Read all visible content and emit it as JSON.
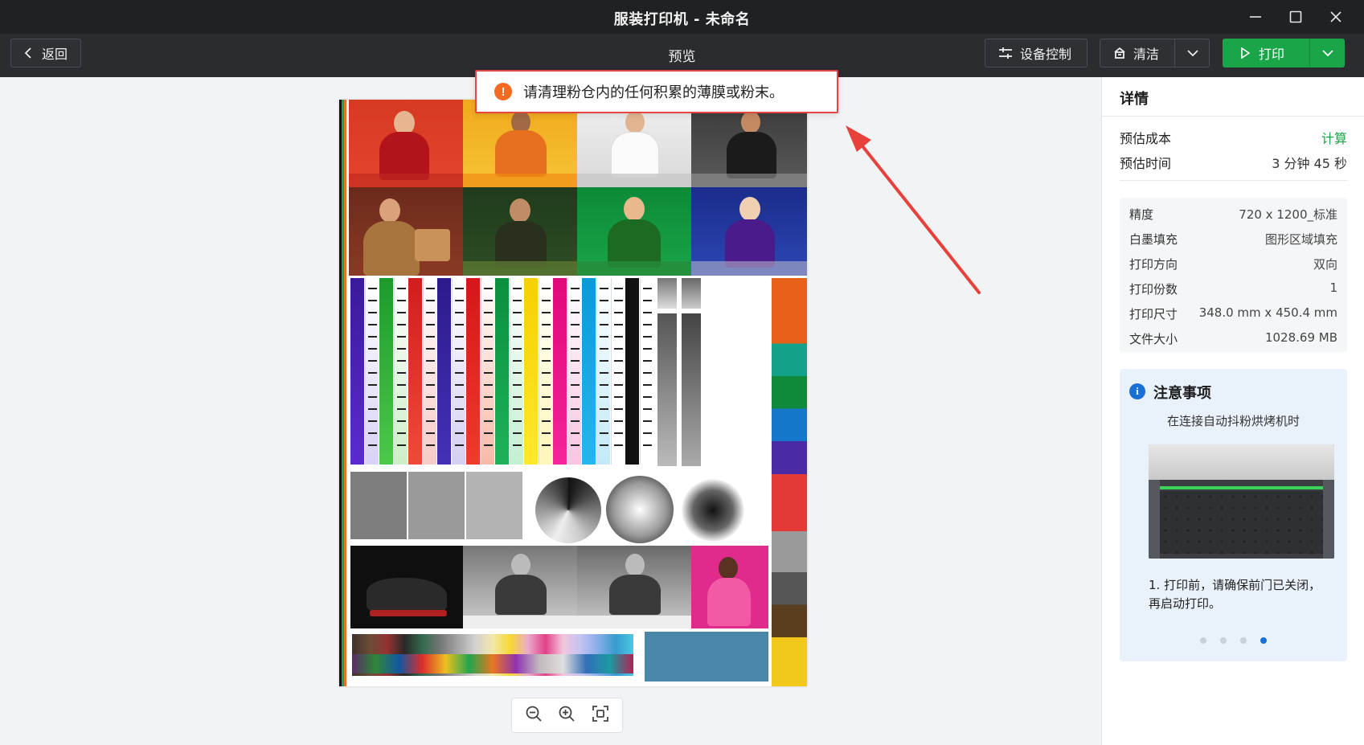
{
  "window": {
    "title": "服装打印机 - 未命名"
  },
  "toolbar": {
    "back_label": "返回",
    "page_title": "预览",
    "device_control_label": "设备控制",
    "clean_label": "清洁",
    "print_label": "打印"
  },
  "toast": {
    "message": "请清理粉仓内的任何积累的薄膜或粉末。"
  },
  "details": {
    "title": "详情",
    "estimated_cost_label": "预估成本",
    "estimated_cost_value": "计算",
    "estimated_time_label": "预估时间",
    "estimated_time_value": "3 分钟 45 秒",
    "specs": [
      {
        "label": "精度",
        "value": "720 x 1200_标准"
      },
      {
        "label": "白墨填充",
        "value": "图形区域填充"
      },
      {
        "label": "打印方向",
        "value": "双向"
      },
      {
        "label": "打印份数",
        "value": "1"
      },
      {
        "label": "打印尺寸",
        "value": "348.0 mm x 450.4 mm"
      },
      {
        "label": "文件大小",
        "value": "1028.69 MB"
      }
    ]
  },
  "notice": {
    "title": "注意事项",
    "subtitle": "在连接自动抖粉烘烤机时",
    "text": "1. 打印前，请确保前门已关闭，再启动打印。",
    "page_count": 4,
    "active_page": 4
  },
  "colors": {
    "accent_green": "#1aa548",
    "toast_border": "#e34740",
    "warning_icon": "#f36a21",
    "info_icon": "#1a6fd6"
  },
  "icons": [
    "chevron-left-icon",
    "sliders-icon",
    "clean-icon",
    "chevron-down-icon",
    "play-icon",
    "zoom-out-icon",
    "zoom-in-icon",
    "fit-screen-icon",
    "warning-icon",
    "info-icon",
    "minimize-icon",
    "maximize-icon",
    "close-icon"
  ]
}
